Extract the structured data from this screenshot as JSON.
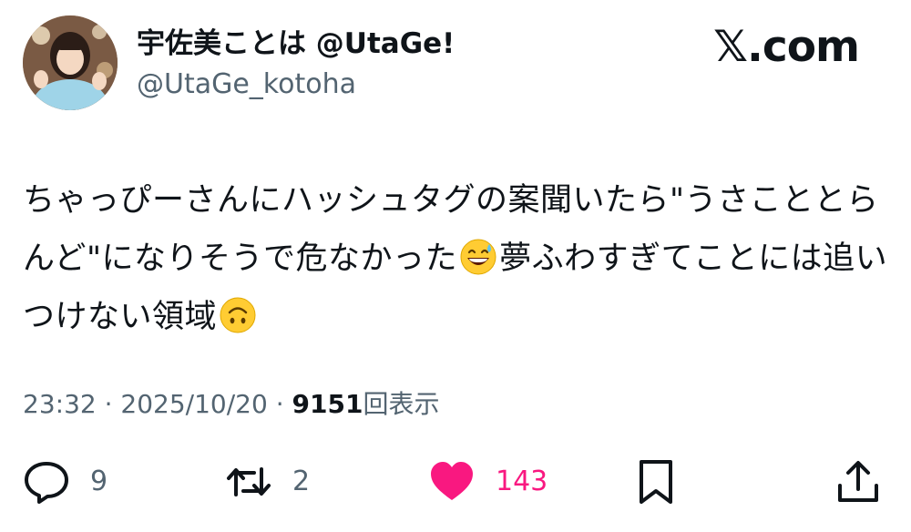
{
  "user": {
    "display_name": "宇佐美ことは @UtaGe!",
    "handle": "@UtaGe_kotoha",
    "avatar_icon": "profile-photo"
  },
  "brand": {
    "logo_letter": "𝕏",
    "logo_suffix": ".com"
  },
  "tweet": {
    "text_part1": "ちゃっぴーさんにハッシュタグの案聞いたら\"うさこととらんど\"になりそうで危なかった",
    "emoji1": "grinning-face-with-sweat",
    "text_part2": "夢ふわすぎてことには追いつけない領域",
    "emoji2": "upside-down-face"
  },
  "meta": {
    "time": "23:32",
    "separator": " · ",
    "date": "2025/10/20",
    "views_count": "9151",
    "views_label": "回表示"
  },
  "actions": {
    "reply_count": "9",
    "repost_count": "2",
    "like_count": "143",
    "like_color": "#f91880",
    "muted_color": "#536471"
  }
}
